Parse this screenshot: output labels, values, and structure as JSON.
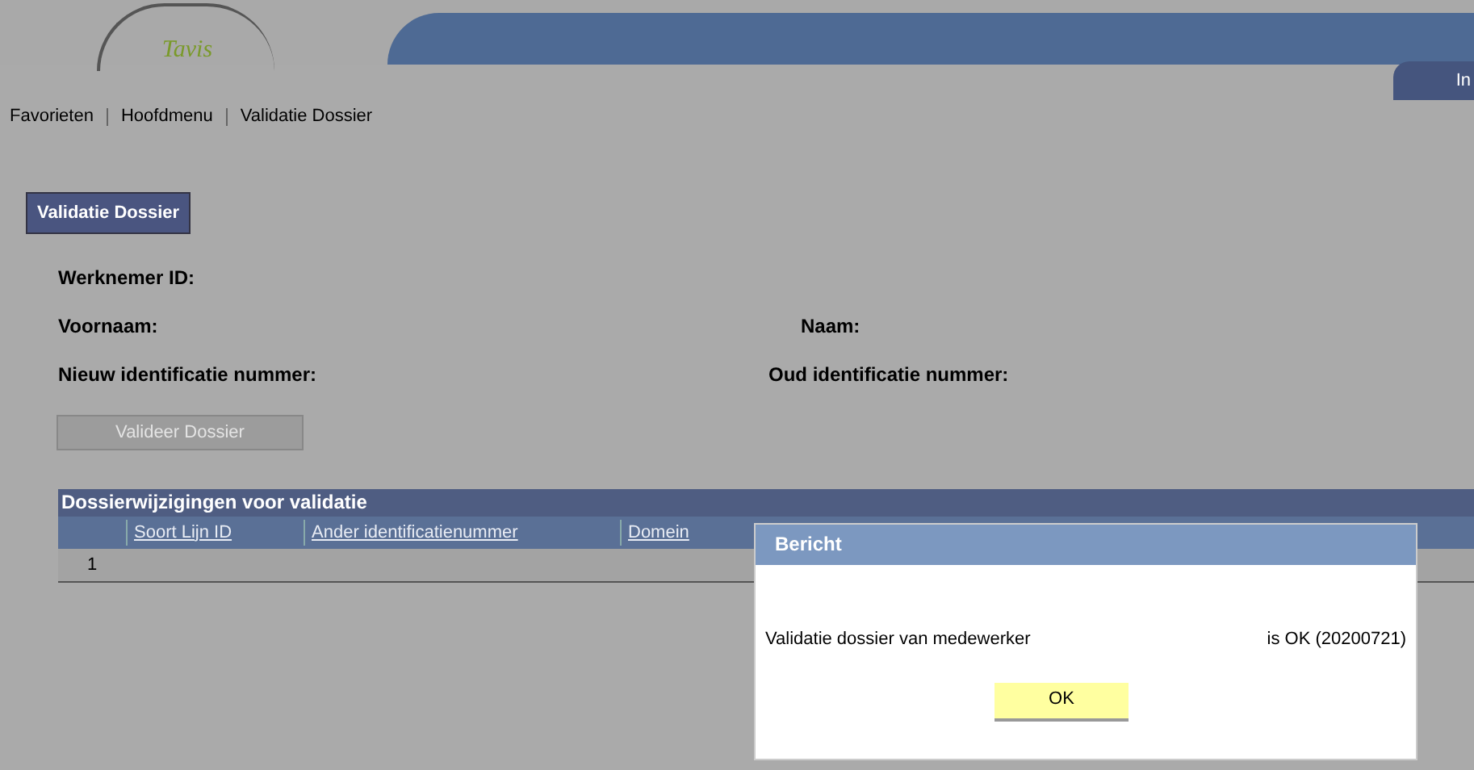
{
  "header": {
    "logo": "Tavis",
    "corner_tab": "In"
  },
  "breadcrumb": [
    "Favorieten",
    "Hoofdmenu",
    "Validatie Dossier"
  ],
  "page_tab": {
    "label": "Validatie Dossier",
    "selected": true
  },
  "fields": [
    {
      "label": "Werknemer ID:"
    },
    {
      "label": "Voornaam:",
      "right_label": "Naam:"
    },
    {
      "label": "Nieuw identificatie nummer:",
      "right_label": "Oud identificatie nummer:"
    }
  ],
  "action_button": {
    "label": "Valideer Dossier",
    "disabled": true
  },
  "grid": {
    "title": "Dossierwijzigingen voor validatie",
    "columns": [
      "Soort Lijn ID",
      "Ander identificatienummer",
      "Domein"
    ],
    "rows": [
      [
        "1"
      ]
    ]
  },
  "dialog": {
    "title": "Bericht",
    "message": "Validatie dossier van medewerker",
    "message_end": "is OK (20200721)",
    "button": "OK"
  }
}
